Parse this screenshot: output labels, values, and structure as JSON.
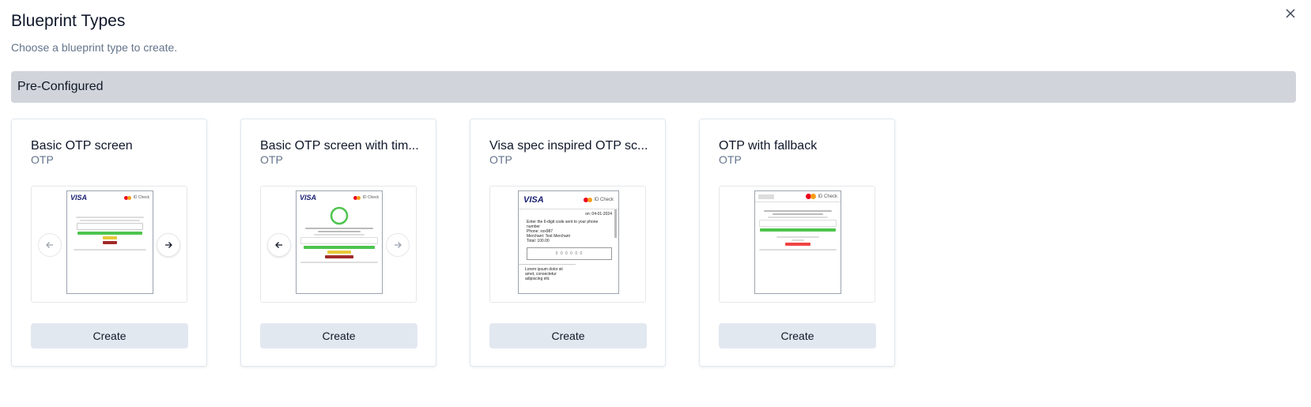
{
  "dialog": {
    "title": "Blueprint Types",
    "subtitle": "Choose a blueprint type to create."
  },
  "section": {
    "label": "Pre-Configured"
  },
  "cards": [
    {
      "title": "Basic OTP screen",
      "category": "OTP",
      "button": "Create"
    },
    {
      "title": "Basic OTP screen with tim...",
      "category": "OTP",
      "button": "Create"
    },
    {
      "title": "Visa spec inspired OTP sc...",
      "category": "OTP",
      "button": "Create"
    },
    {
      "title": "OTP with fallback",
      "category": "OTP",
      "button": "Create"
    }
  ],
  "previews": {
    "visa": "VISA",
    "id_check": "ID Check",
    "p3": {
      "date": "on: 04-01-2024",
      "instructions": "Enter the 6-digit code sent to your phone number",
      "phone": "Phone: xxx987",
      "merchant": "Merchant: Test Merchant",
      "total": "Total: 100.00",
      "code_placeholder": "0 0 0 0 0 0",
      "lorem": "Lorem ipsum dolor sit amet, consectetur adipiscing elit."
    }
  },
  "colors": {
    "section_bg": "#d1d5db",
    "button_bg": "#e2e8f0",
    "subtitle": "#64748b",
    "visa_blue": "#1a1f71",
    "submit_green": "#4ec44e",
    "resend_yellow": "#e6c93a",
    "cancel_red": "#a12a2a"
  },
  "icons": {
    "close": "close-icon",
    "prev": "arrow-left-icon",
    "next": "arrow-right-icon"
  }
}
